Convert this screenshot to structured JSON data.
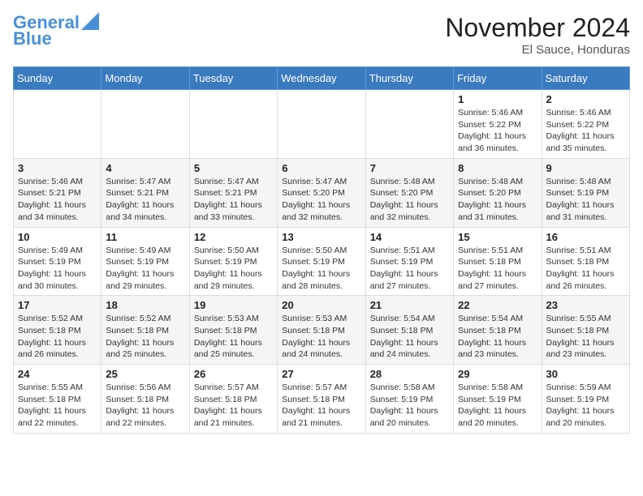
{
  "header": {
    "logo_line1": "General",
    "logo_line2": "Blue",
    "month_title": "November 2024",
    "location": "El Sauce, Honduras"
  },
  "days_of_week": [
    "Sunday",
    "Monday",
    "Tuesday",
    "Wednesday",
    "Thursday",
    "Friday",
    "Saturday"
  ],
  "weeks": [
    [
      {
        "day": "",
        "info": ""
      },
      {
        "day": "",
        "info": ""
      },
      {
        "day": "",
        "info": ""
      },
      {
        "day": "",
        "info": ""
      },
      {
        "day": "",
        "info": ""
      },
      {
        "day": "1",
        "info": "Sunrise: 5:46 AM\nSunset: 5:22 PM\nDaylight: 11 hours and 36 minutes."
      },
      {
        "day": "2",
        "info": "Sunrise: 5:46 AM\nSunset: 5:22 PM\nDaylight: 11 hours and 35 minutes."
      }
    ],
    [
      {
        "day": "3",
        "info": "Sunrise: 5:46 AM\nSunset: 5:21 PM\nDaylight: 11 hours and 34 minutes."
      },
      {
        "day": "4",
        "info": "Sunrise: 5:47 AM\nSunset: 5:21 PM\nDaylight: 11 hours and 34 minutes."
      },
      {
        "day": "5",
        "info": "Sunrise: 5:47 AM\nSunset: 5:21 PM\nDaylight: 11 hours and 33 minutes."
      },
      {
        "day": "6",
        "info": "Sunrise: 5:47 AM\nSunset: 5:20 PM\nDaylight: 11 hours and 32 minutes."
      },
      {
        "day": "7",
        "info": "Sunrise: 5:48 AM\nSunset: 5:20 PM\nDaylight: 11 hours and 32 minutes."
      },
      {
        "day": "8",
        "info": "Sunrise: 5:48 AM\nSunset: 5:20 PM\nDaylight: 11 hours and 31 minutes."
      },
      {
        "day": "9",
        "info": "Sunrise: 5:48 AM\nSunset: 5:19 PM\nDaylight: 11 hours and 31 minutes."
      }
    ],
    [
      {
        "day": "10",
        "info": "Sunrise: 5:49 AM\nSunset: 5:19 PM\nDaylight: 11 hours and 30 minutes."
      },
      {
        "day": "11",
        "info": "Sunrise: 5:49 AM\nSunset: 5:19 PM\nDaylight: 11 hours and 29 minutes."
      },
      {
        "day": "12",
        "info": "Sunrise: 5:50 AM\nSunset: 5:19 PM\nDaylight: 11 hours and 29 minutes."
      },
      {
        "day": "13",
        "info": "Sunrise: 5:50 AM\nSunset: 5:19 PM\nDaylight: 11 hours and 28 minutes."
      },
      {
        "day": "14",
        "info": "Sunrise: 5:51 AM\nSunset: 5:19 PM\nDaylight: 11 hours and 27 minutes."
      },
      {
        "day": "15",
        "info": "Sunrise: 5:51 AM\nSunset: 5:18 PM\nDaylight: 11 hours and 27 minutes."
      },
      {
        "day": "16",
        "info": "Sunrise: 5:51 AM\nSunset: 5:18 PM\nDaylight: 11 hours and 26 minutes."
      }
    ],
    [
      {
        "day": "17",
        "info": "Sunrise: 5:52 AM\nSunset: 5:18 PM\nDaylight: 11 hours and 26 minutes."
      },
      {
        "day": "18",
        "info": "Sunrise: 5:52 AM\nSunset: 5:18 PM\nDaylight: 11 hours and 25 minutes."
      },
      {
        "day": "19",
        "info": "Sunrise: 5:53 AM\nSunset: 5:18 PM\nDaylight: 11 hours and 25 minutes."
      },
      {
        "day": "20",
        "info": "Sunrise: 5:53 AM\nSunset: 5:18 PM\nDaylight: 11 hours and 24 minutes."
      },
      {
        "day": "21",
        "info": "Sunrise: 5:54 AM\nSunset: 5:18 PM\nDaylight: 11 hours and 24 minutes."
      },
      {
        "day": "22",
        "info": "Sunrise: 5:54 AM\nSunset: 5:18 PM\nDaylight: 11 hours and 23 minutes."
      },
      {
        "day": "23",
        "info": "Sunrise: 5:55 AM\nSunset: 5:18 PM\nDaylight: 11 hours and 23 minutes."
      }
    ],
    [
      {
        "day": "24",
        "info": "Sunrise: 5:55 AM\nSunset: 5:18 PM\nDaylight: 11 hours and 22 minutes."
      },
      {
        "day": "25",
        "info": "Sunrise: 5:56 AM\nSunset: 5:18 PM\nDaylight: 11 hours and 22 minutes."
      },
      {
        "day": "26",
        "info": "Sunrise: 5:57 AM\nSunset: 5:18 PM\nDaylight: 11 hours and 21 minutes."
      },
      {
        "day": "27",
        "info": "Sunrise: 5:57 AM\nSunset: 5:18 PM\nDaylight: 11 hours and 21 minutes."
      },
      {
        "day": "28",
        "info": "Sunrise: 5:58 AM\nSunset: 5:19 PM\nDaylight: 11 hours and 20 minutes."
      },
      {
        "day": "29",
        "info": "Sunrise: 5:58 AM\nSunset: 5:19 PM\nDaylight: 11 hours and 20 minutes."
      },
      {
        "day": "30",
        "info": "Sunrise: 5:59 AM\nSunset: 5:19 PM\nDaylight: 11 hours and 20 minutes."
      }
    ]
  ]
}
